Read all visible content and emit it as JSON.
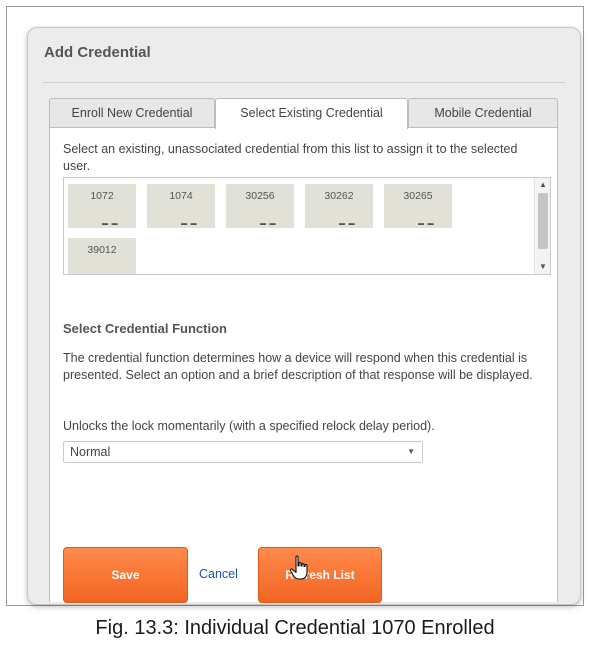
{
  "dialog": {
    "title": "Add Credential"
  },
  "tabs": [
    {
      "label": "Enroll New Credential",
      "active": false
    },
    {
      "label": "Select Existing Credential",
      "active": true
    },
    {
      "label": "Mobile Credential",
      "active": false
    }
  ],
  "select_existing": {
    "intro": "Select an existing, unassociated credential from this list to assign it to the selected user.",
    "credentials": [
      "1072",
      "1074",
      "30256",
      "30262",
      "30265",
      "39012"
    ]
  },
  "credential_function": {
    "title": "Select Credential Function",
    "description": "The credential function determines how a device will respond when this credential is presented. Select an option and a brief description of that response will be displayed.",
    "help": "Unlocks the lock momentarily (with a specified relock delay period).",
    "selected": "Normal"
  },
  "actions": {
    "save_label": "Save",
    "cancel_label": "Cancel",
    "refresh_label": "Refresh List"
  },
  "caption": "Fig. 13.3: Individual Credential 1070 Enrolled",
  "icons": {
    "scroll_up": "scroll-up-arrow-icon",
    "scroll_down": "scroll-down-arrow-icon",
    "dropdown": "chevron-down-icon",
    "cursor": "hand-pointer-icon"
  },
  "colors": {
    "button_orange": "#f26522",
    "link_blue": "#1f4fa8",
    "card_bg": "#e1e1d8",
    "dialog_bg": "#ececec"
  }
}
